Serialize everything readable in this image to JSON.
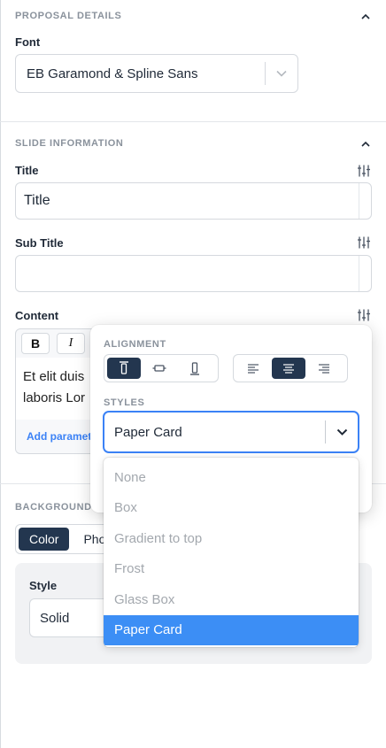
{
  "proposal": {
    "section_title": "PROPOSAL DETAILS",
    "font_label": "Font",
    "font_value": "EB Garamond & Spline Sans"
  },
  "slide": {
    "section_title": "SLIDE INFORMATION",
    "title_label": "Title",
    "title_value": "Title",
    "subtitle_label": "Sub Title",
    "subtitle_value": "",
    "content_label": "Content",
    "content_text_line1": "Et elit duis",
    "content_text_line2": "laboris Lor",
    "bold_label": "B",
    "italic_label": "I",
    "add_parameter_label": "Add paramete"
  },
  "background": {
    "section_title": "BACKGROUND",
    "tabs": [
      "Color",
      "Phot"
    ],
    "style_label": "Style",
    "style_value": "Solid"
  },
  "popover": {
    "alignment_label": "ALIGNMENT",
    "styles_label": "STYLES",
    "styles_value": "Paper Card",
    "options": [
      "None",
      "Box",
      "Gradient to top",
      "Frost",
      "Glass Box",
      "Paper Card"
    ],
    "selected_option": "Paper Card"
  },
  "colors": {
    "primary_dark": "#23364f",
    "accent_blue": "#3c8ef5",
    "link_blue": "#3b82f6",
    "muted_label": "#8a929c"
  }
}
